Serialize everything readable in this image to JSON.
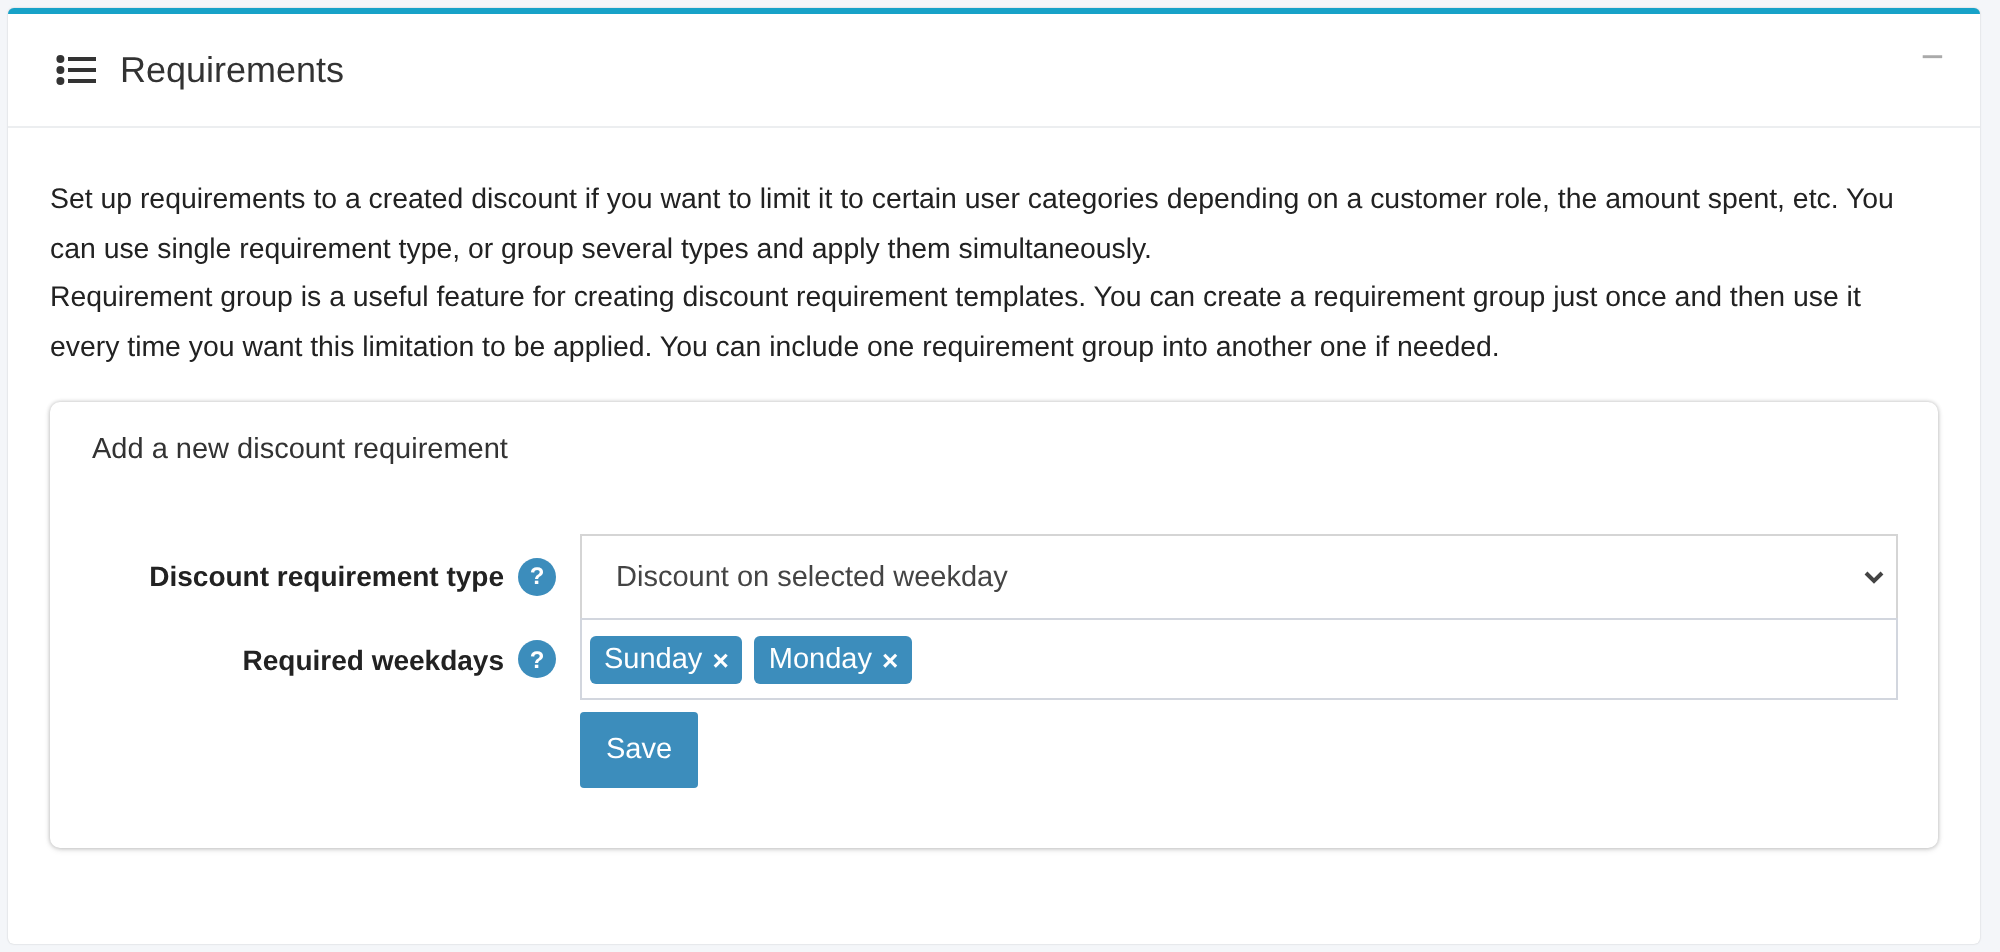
{
  "card": {
    "title": "Requirements",
    "collapse_symbol": "−"
  },
  "description": [
    "Set up requirements to a created discount if you want to limit it to certain user categories depending on a customer role, the amount spent, etc. You can use single requirement type, or group several types and apply them simultaneously.",
    "Requirement group is a useful feature for creating discount requirement templates. You can create a requirement group just once and then use it every time you want this limitation to be applied. You can include one requirement group into another one if needed."
  ],
  "form": {
    "title": "Add a new discount requirement",
    "fields": [
      {
        "kind": "select",
        "label": "Discount requirement type",
        "help": "?",
        "value": "Discount on selected weekday"
      },
      {
        "kind": "tags",
        "label": "Required weekdays",
        "help": "?",
        "tags": [
          {
            "label": "Sunday",
            "remove": "×"
          },
          {
            "label": "Monday",
            "remove": "×"
          }
        ]
      }
    ],
    "save_button": "Save"
  }
}
